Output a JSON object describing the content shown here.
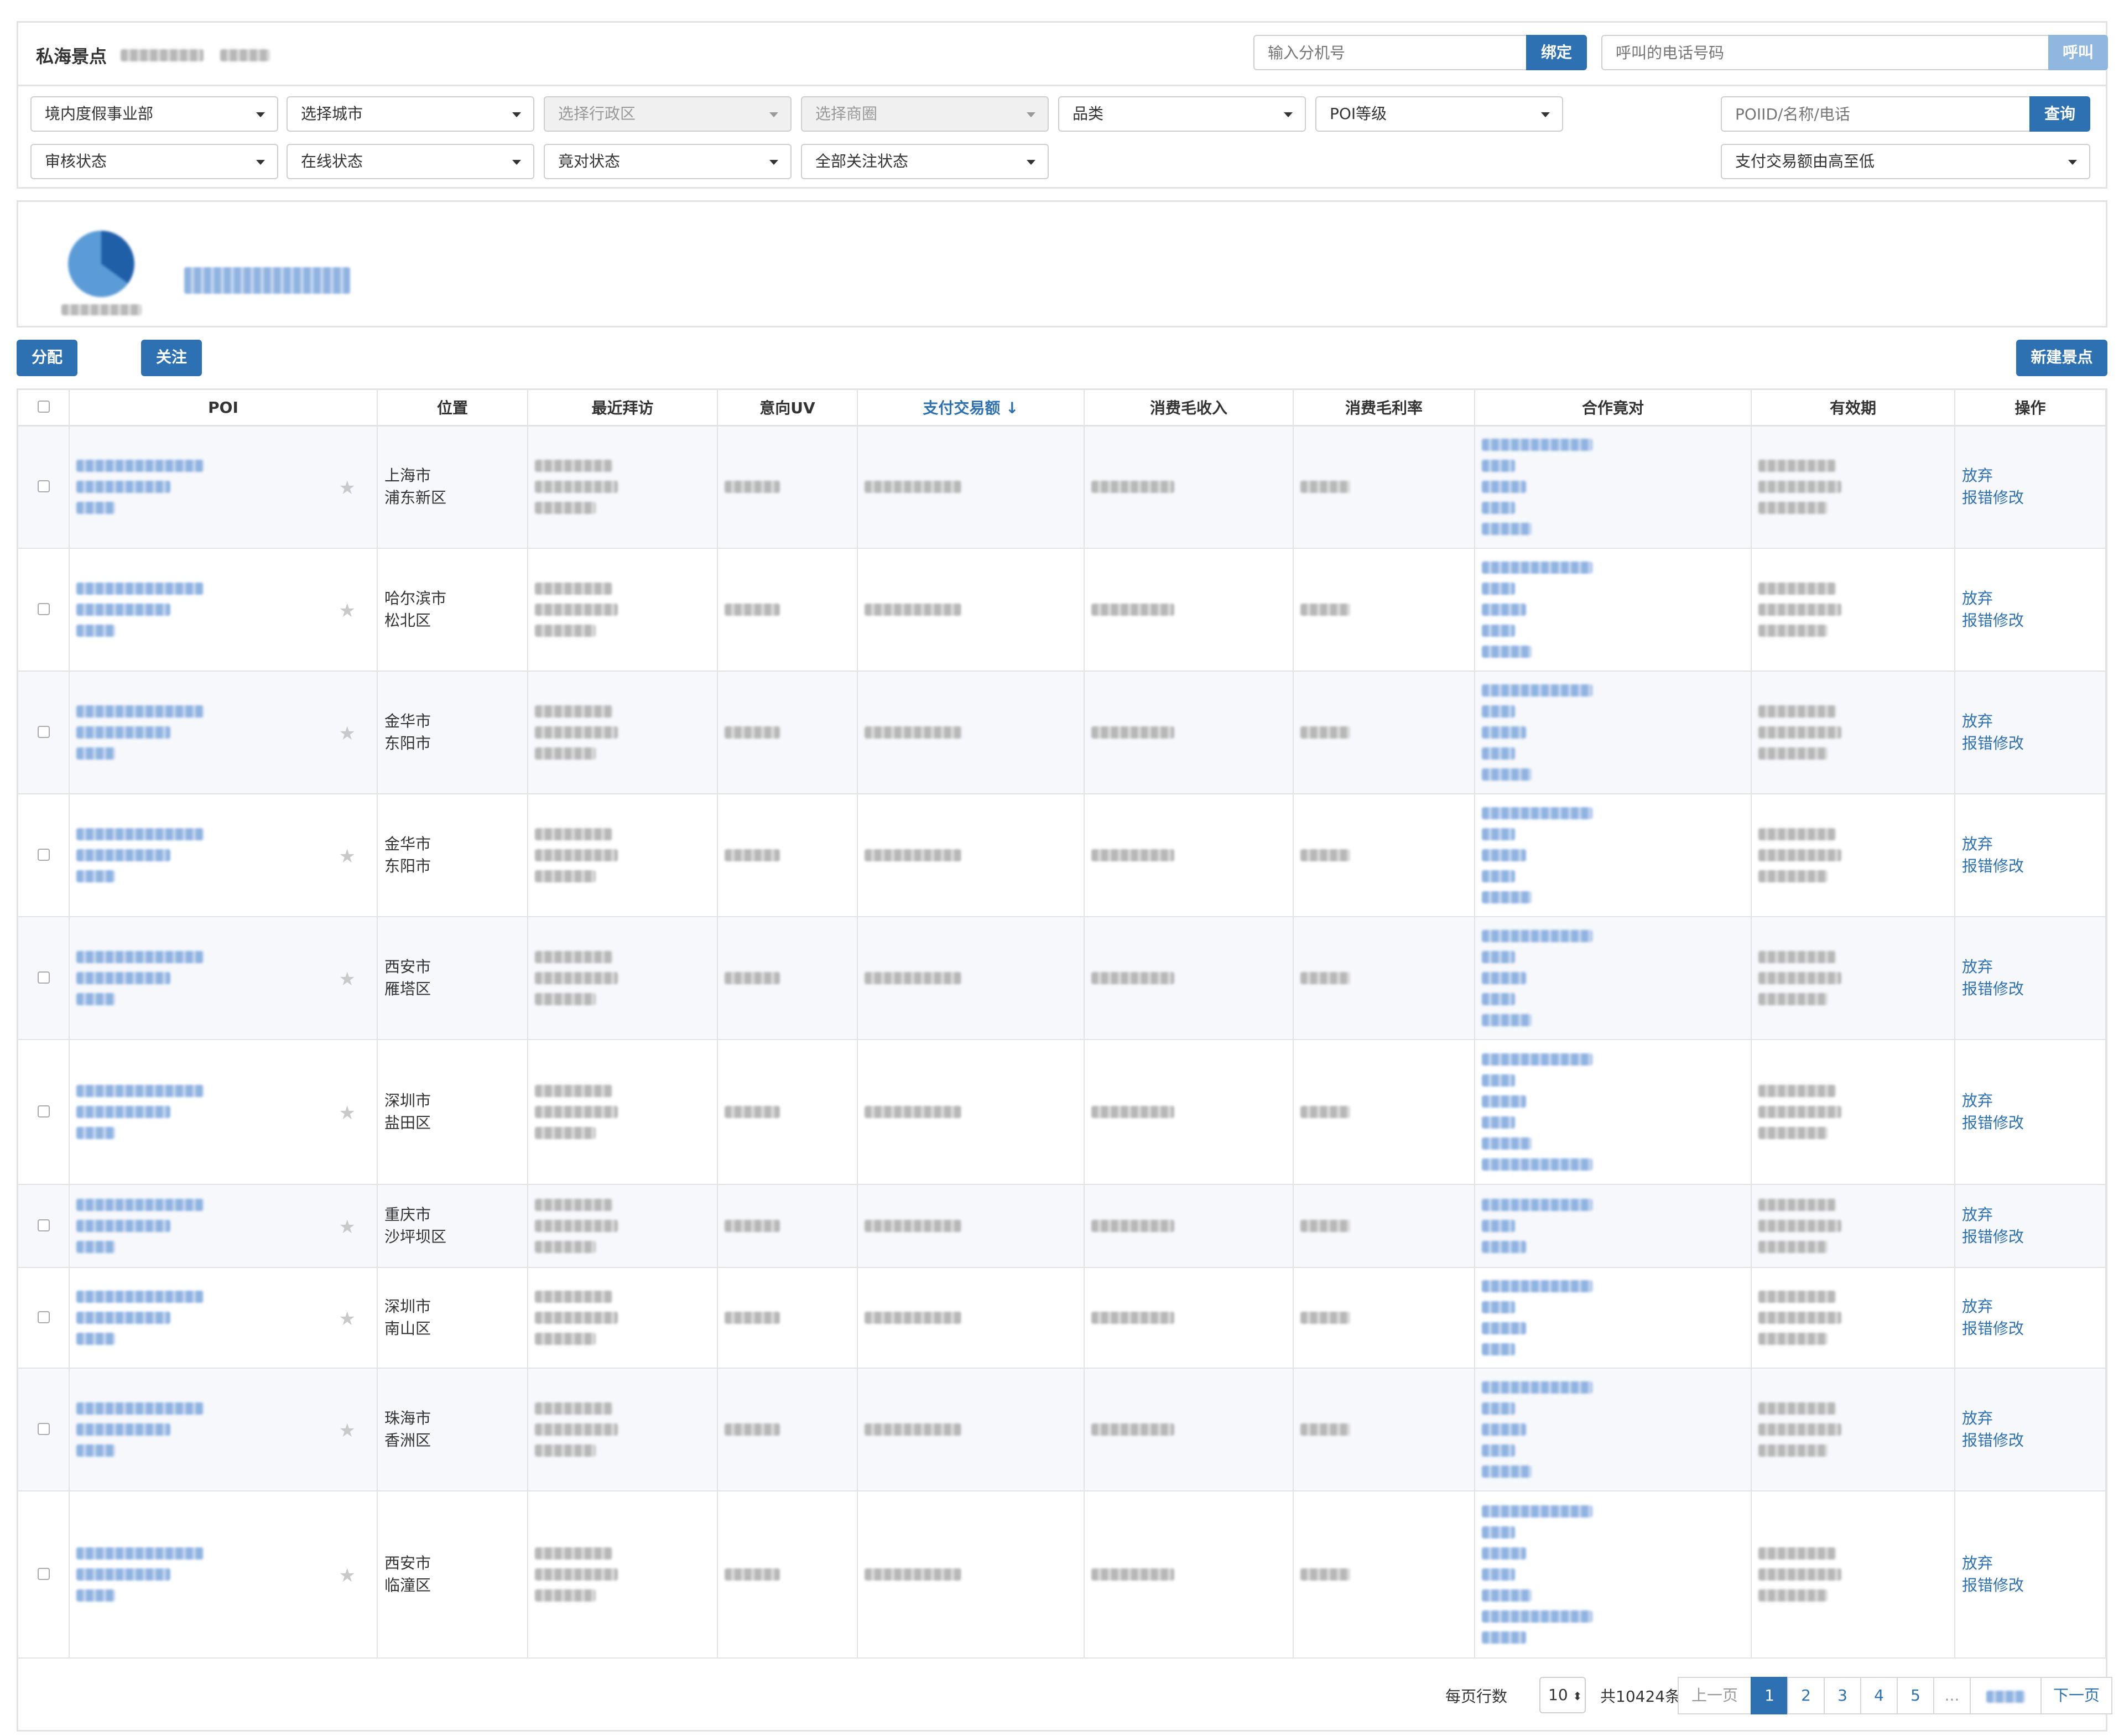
{
  "header": {
    "title": "私海景点",
    "extension_placeholder": "输入分机号",
    "bind_label": "绑定",
    "phone_placeholder": "呼叫的电话号码",
    "call_label": "呼叫"
  },
  "filters": {
    "row1": [
      "境内度假事业部",
      "选择城市",
      "选择行政区",
      "选择商圈",
      "品类",
      "POI等级"
    ],
    "row2": [
      "审核状态",
      "在线状态",
      "竟对状态",
      "全部关注状态"
    ],
    "search_placeholder": "POIID/名称/电话",
    "search_label": "查询",
    "sort_label": "支付交易额由高至低"
  },
  "actions": {
    "assign": "分配",
    "follow": "关注",
    "new_poi": "新建景点"
  },
  "table": {
    "headers": [
      "POI",
      "位置",
      "最近拜访",
      "意向UV",
      "支付交易额 ↓",
      "消费毛收入",
      "消费毛利率",
      "合作竟对",
      "有效期",
      "操作"
    ],
    "rows": [
      {
        "city": "上海市",
        "district": "浦东新区",
        "op1": "放弃",
        "op2": "报错修改"
      },
      {
        "city": "哈尔滨市",
        "district": "松北区",
        "op1": "放弃",
        "op2": "报错修改"
      },
      {
        "city": "金华市",
        "district": "东阳市",
        "op1": "放弃",
        "op2": "报错修改"
      },
      {
        "city": "金华市",
        "district": "东阳市",
        "op1": "放弃",
        "op2": "报错修改"
      },
      {
        "city": "西安市",
        "district": "雁塔区",
        "op1": "放弃",
        "op2": "报错修改"
      },
      {
        "city": "深圳市",
        "district": "盐田区",
        "op1": "放弃",
        "op2": "报错修改"
      },
      {
        "city": "重庆市",
        "district": "沙坪坝区",
        "op1": "放弃",
        "op2": "报错修改"
      },
      {
        "city": "深圳市",
        "district": "南山区",
        "op1": "放弃",
        "op2": "报错修改"
      },
      {
        "city": "珠海市",
        "district": "香洲区",
        "op1": "放弃",
        "op2": "报错修改"
      },
      {
        "city": "西安市",
        "district": "临潼区",
        "op1": "放弃",
        "op2": "报错修改"
      }
    ]
  },
  "pagination": {
    "page_size_label": "每页行数",
    "page_size": "10",
    "total": "共10424条",
    "prev": "上一页",
    "pages": [
      "1",
      "2",
      "3",
      "4",
      "5",
      "..."
    ],
    "next": "下一页"
  }
}
